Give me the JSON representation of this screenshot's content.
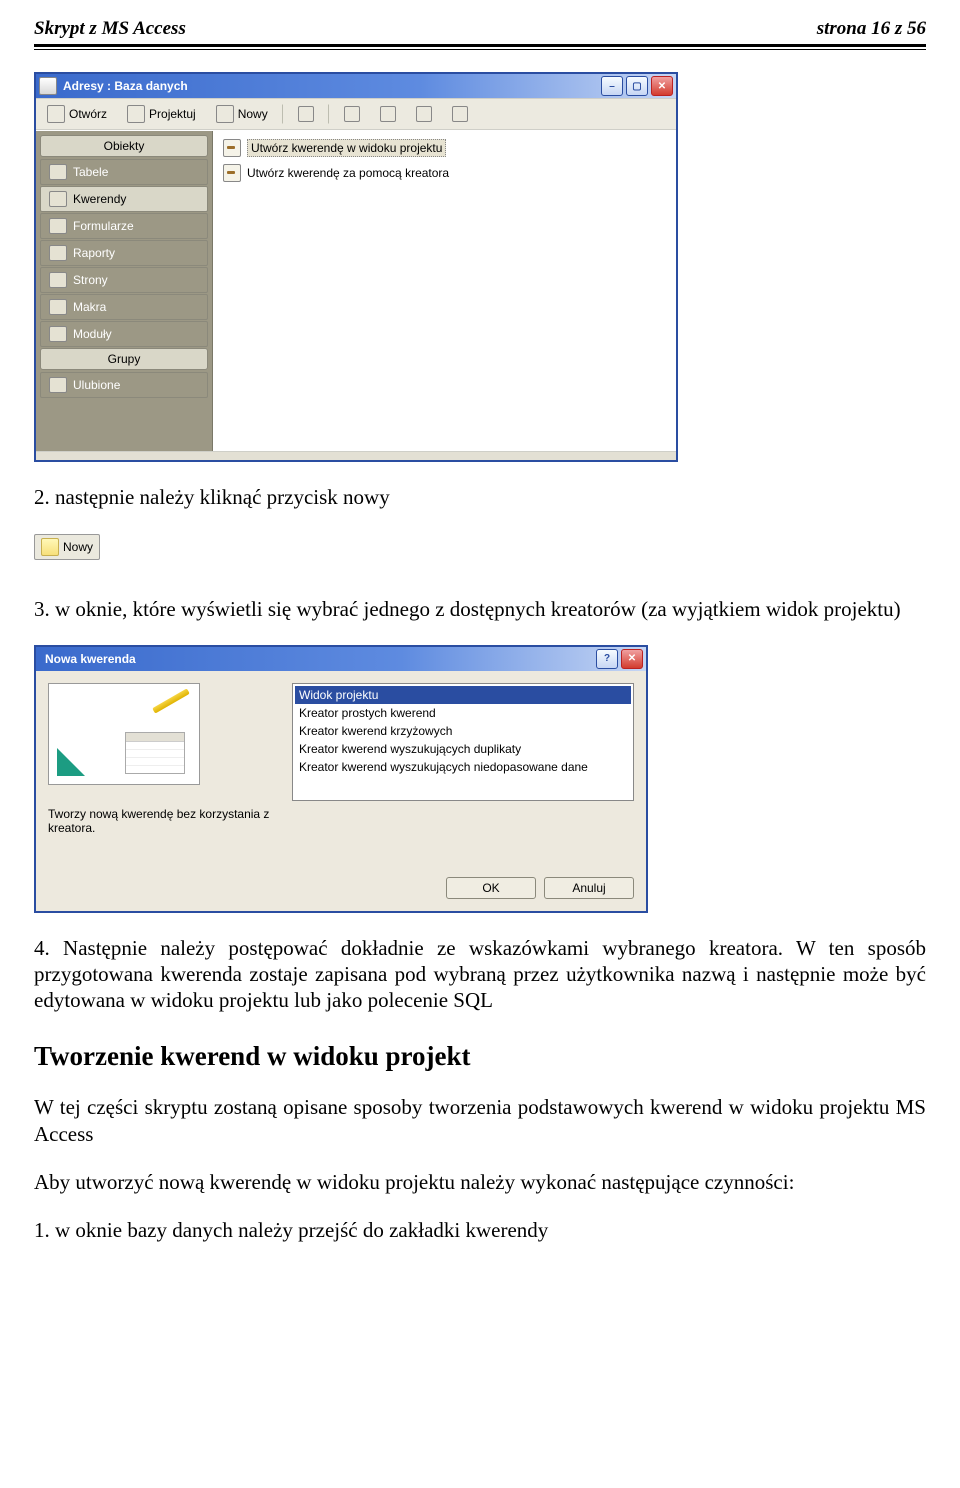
{
  "header": {
    "left": "Skrypt z MS  Access",
    "right": "strona 16 z 56"
  },
  "win1": {
    "title": "Adresy : Baza danych",
    "toolbar": {
      "open": "Otwórz",
      "design": "Projektuj",
      "new": "Nowy"
    },
    "sidebar": {
      "group1_label": "Obiekty",
      "items1": [
        "Tabele",
        "Kwerendy",
        "Formularze",
        "Raporty",
        "Strony",
        "Makra",
        "Moduły"
      ],
      "group2_label": "Grupy",
      "items2": [
        "Ulubione"
      ]
    },
    "main": {
      "opt1": "Utwórz kwerendę w widoku projektu",
      "opt2": "Utwórz kwerendę za pomocą kreatora"
    }
  },
  "p2": "2. następnie należy kliknąć przycisk nowy",
  "nowy_label": "Nowy",
  "p3": "3. w oknie, które wyświetli się wybrać jednego z dostępnych kreatorów (za wyjątkiem widok projektu)",
  "dlg": {
    "title": "Nowa kwerenda",
    "options": [
      "Widok projektu",
      "Kreator prostych kwerend",
      "Kreator kwerend krzyżowych",
      "Kreator kwerend wyszukujących duplikaty",
      "Kreator kwerend wyszukujących niedopasowane dane"
    ],
    "desc": "Tworzy nową kwerendę bez korzystania z kreatora.",
    "ok": "OK",
    "cancel": "Anuluj"
  },
  "p4": "4. Następnie należy postępować dokładnie ze wskazówkami wybranego kreatora. W ten sposób przygotowana kwerenda zostaje zapisana pod wybraną przez użytkownika nazwą i następnie może być edytowana w widoku projektu lub jako polecenie SQL",
  "h2": "Tworzenie kwerend w widoku projekt",
  "p5": "W tej części skryptu zostaną opisane sposoby tworzenia podstawowych kwerend w widoku projektu MS Access",
  "p6": "Aby utworzyć nową kwerendę w widoku projektu należy wykonać następujące czynności:",
  "p7": "1. w oknie bazy danych należy przejść do zakładki kwerendy"
}
